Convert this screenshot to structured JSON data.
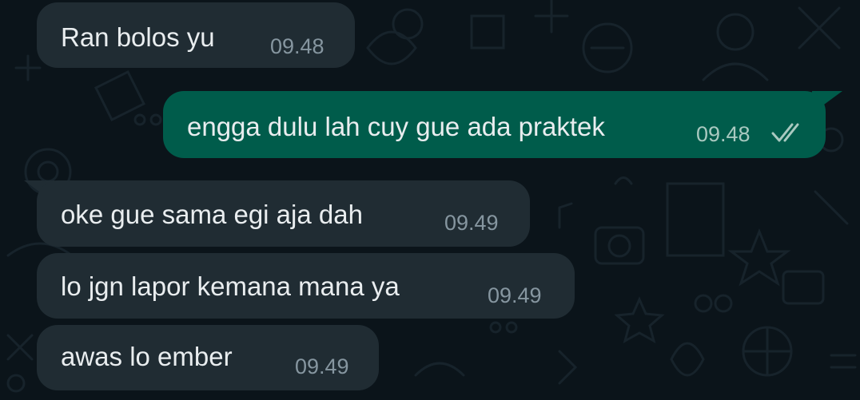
{
  "messages": [
    {
      "direction": "incoming",
      "text": "Ran bolos yu",
      "time": "09.48"
    },
    {
      "direction": "outgoing",
      "text": "engga dulu lah cuy gue ada praktek",
      "time": "09.48",
      "status_icon": "double-check-icon"
    },
    {
      "direction": "incoming",
      "text": "oke gue sama egi aja dah",
      "time": "09.49"
    },
    {
      "direction": "incoming",
      "text": "lo jgn lapor kemana mana ya",
      "time": "09.49"
    },
    {
      "direction": "incoming",
      "text": "awas lo ember",
      "time": "09.49"
    }
  ],
  "colors": {
    "background": "#0b141a",
    "incoming_bubble": "#202c33",
    "outgoing_bubble": "#005c4b",
    "text": "#e9edef",
    "timestamp": "#8696a0"
  }
}
